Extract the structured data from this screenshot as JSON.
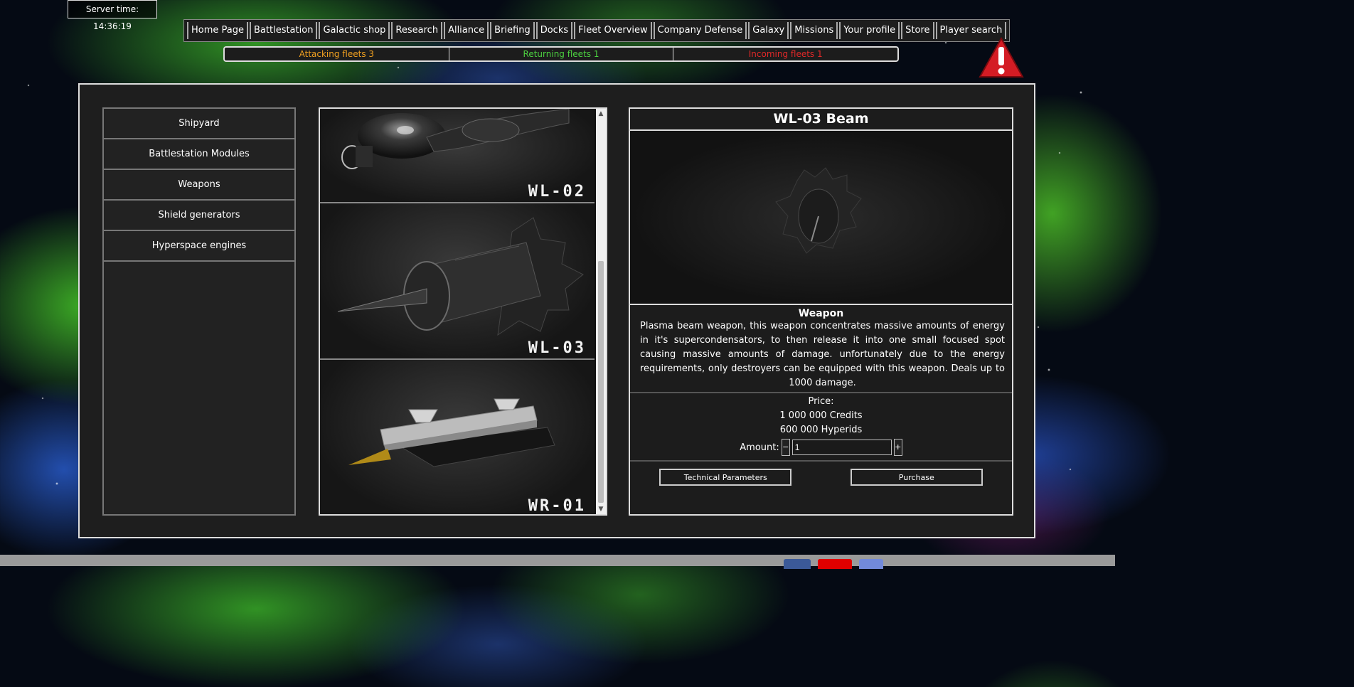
{
  "server_time": "Server time: 14:36:19",
  "nav": [
    "Home Page",
    "Battlestation",
    "Galactic shop",
    "Research",
    "Alliance",
    "Briefing",
    "Docks",
    "Fleet Overview",
    "Company Defense",
    "Galaxy",
    "Missions",
    "Your profile",
    "Store",
    "Player search"
  ],
  "fleets": {
    "attacking": "Attacking fleets 3",
    "returning": "Returning fleets 1",
    "incoming": "Incoming fleets 1"
  },
  "colors": {
    "attacking": "#f0a020",
    "returning": "#4cd040",
    "incoming": "#e02828",
    "warning": "#d41c24"
  },
  "sidebar": [
    "Shipyard",
    "Battlestation Modules",
    "Weapons",
    "Shield generators",
    "Hyperspace engines"
  ],
  "gallery": {
    "items": [
      {
        "label": "WL-02"
      },
      {
        "label": "WL-03"
      },
      {
        "label": "WR-01"
      }
    ]
  },
  "detail": {
    "title": "WL-03 Beam",
    "type": "Weapon",
    "description": "Plasma beam weapon, this weapon concentrates massive amounts of energy in it's supercondensators, to then release it into one small focused spot causing massive amounts of damage. unfortunately due to the energy requirements, only destroyers can be equipped with this weapon. Deals up to 1000 damage.",
    "price_label": "Price:",
    "price_credits": "1 000 000 Credits",
    "price_hyperids": "600 000 Hyperids",
    "amount_label": "Amount:",
    "amount_value": "1",
    "minus": "−",
    "plus": "+",
    "technical_button": "Technical Parameters",
    "purchase_button": "Purchase"
  },
  "icons": {
    "warning": "warning-triangle-icon",
    "facebook": "facebook-icon",
    "youtube": "youtube-icon"
  }
}
